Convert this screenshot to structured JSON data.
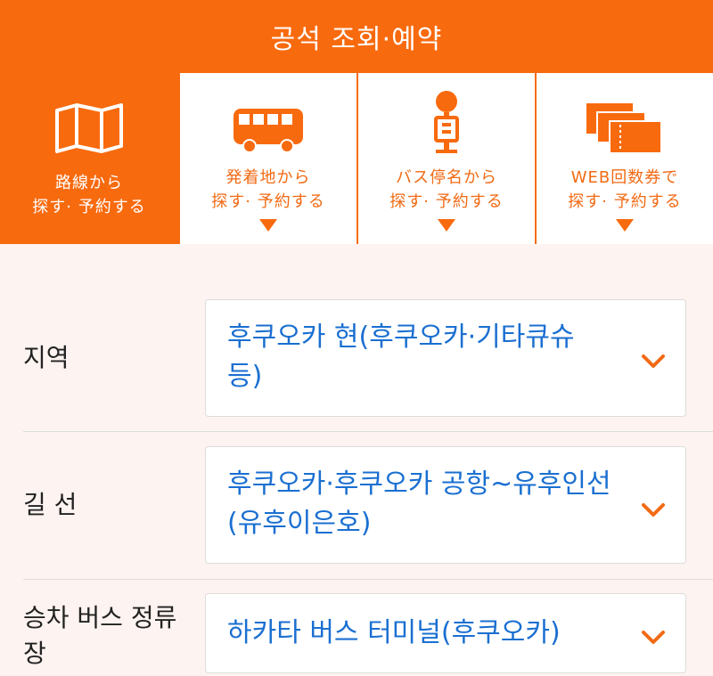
{
  "header": {
    "title": "공석 조회·예약"
  },
  "tabs": [
    {
      "line1": "路線から",
      "line2": "探す· 予約する",
      "icon": "map-icon",
      "active": true
    },
    {
      "line1": "発着地から",
      "line2": "探す· 予約する",
      "icon": "bus-icon",
      "active": false
    },
    {
      "line1": "バス停名から",
      "line2": "探す· 予約する",
      "icon": "bus-stop-icon",
      "active": false
    },
    {
      "line1": "WEB回数券で",
      "line2": "探す· 予約する",
      "icon": "tickets-icon",
      "active": false
    }
  ],
  "form": {
    "region": {
      "label": "지역",
      "value": "후쿠오카 현(후쿠오카·기타큐슈 등)"
    },
    "route": {
      "label": "길 선",
      "value": "후쿠오카·후쿠오카 공항~유후인선(유후이은호)"
    },
    "boarding": {
      "label": "승차 버스 정류장",
      "value": "하카타 버스 터미널(후쿠오카)"
    }
  },
  "colors": {
    "brand": "#f86a0e",
    "link": "#1a6fd1",
    "background": "#fdf3f0"
  }
}
